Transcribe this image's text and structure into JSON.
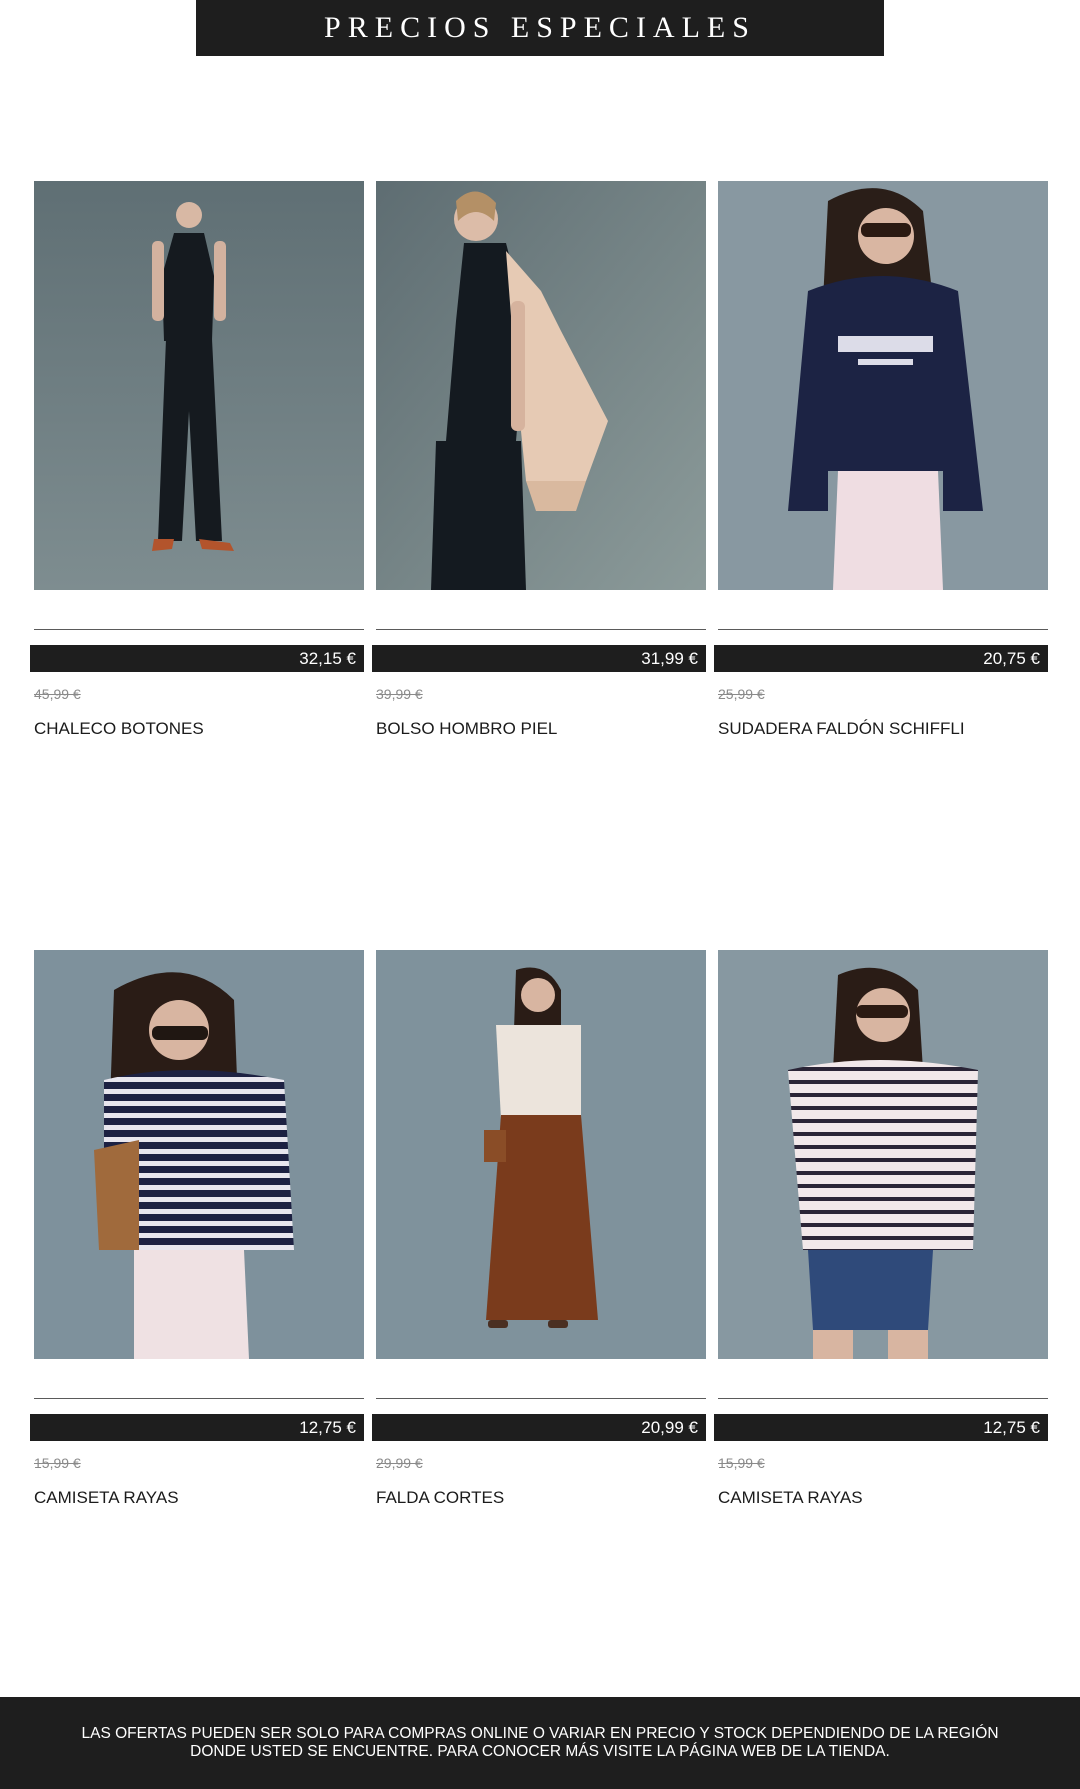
{
  "header": {
    "title": "PRECIOS ESPECIALES"
  },
  "colors": {
    "banner_bg": "#1e1e1e",
    "price_bg": "#1e1e1e",
    "photo_bg": "#7d8e96"
  },
  "products": [
    {
      "name": "CHALECO BOTONES",
      "price": "32,15 €",
      "old_price": "45,99 €",
      "image": "woman-black-vest-and-trousers"
    },
    {
      "name": "BOLSO HOMBRO PIEL",
      "price": "31,99 €",
      "old_price": "39,99 €",
      "image": "woman-with-fringed-leather-shoulder-bag"
    },
    {
      "name": "SUDADERA FALDÓN SCHIFFLI",
      "price": "20,75 €",
      "old_price": "25,99 €",
      "image": "woman-navy-sweatshirt-porto-do-mos"
    },
    {
      "name": "CAMISETA RAYAS",
      "price": "12,75 €",
      "old_price": "15,99 €",
      "image": "woman-navy-striped-tee"
    },
    {
      "name": "FALDA CORTES",
      "price": "20,99 €",
      "old_price": "29,99 €",
      "image": "woman-brown-tiered-skirt"
    },
    {
      "name": "CAMISETA RAYAS",
      "price": "12,75 €",
      "old_price": "15,99 €",
      "image": "woman-white-striped-tee-denim-shorts"
    }
  ],
  "footer": {
    "line1": "LAS OFERTAS PUEDEN SER SOLO PARA COMPRAS ONLINE O VARIAR EN PRECIO Y STOCK DEPENDIENDO DE LA REGIÓN",
    "line2": "DONDE USTED SE ENCUENTRE. PARA CONOCER MÁS VISITE LA PÁGINA WEB DE LA TIENDA."
  }
}
